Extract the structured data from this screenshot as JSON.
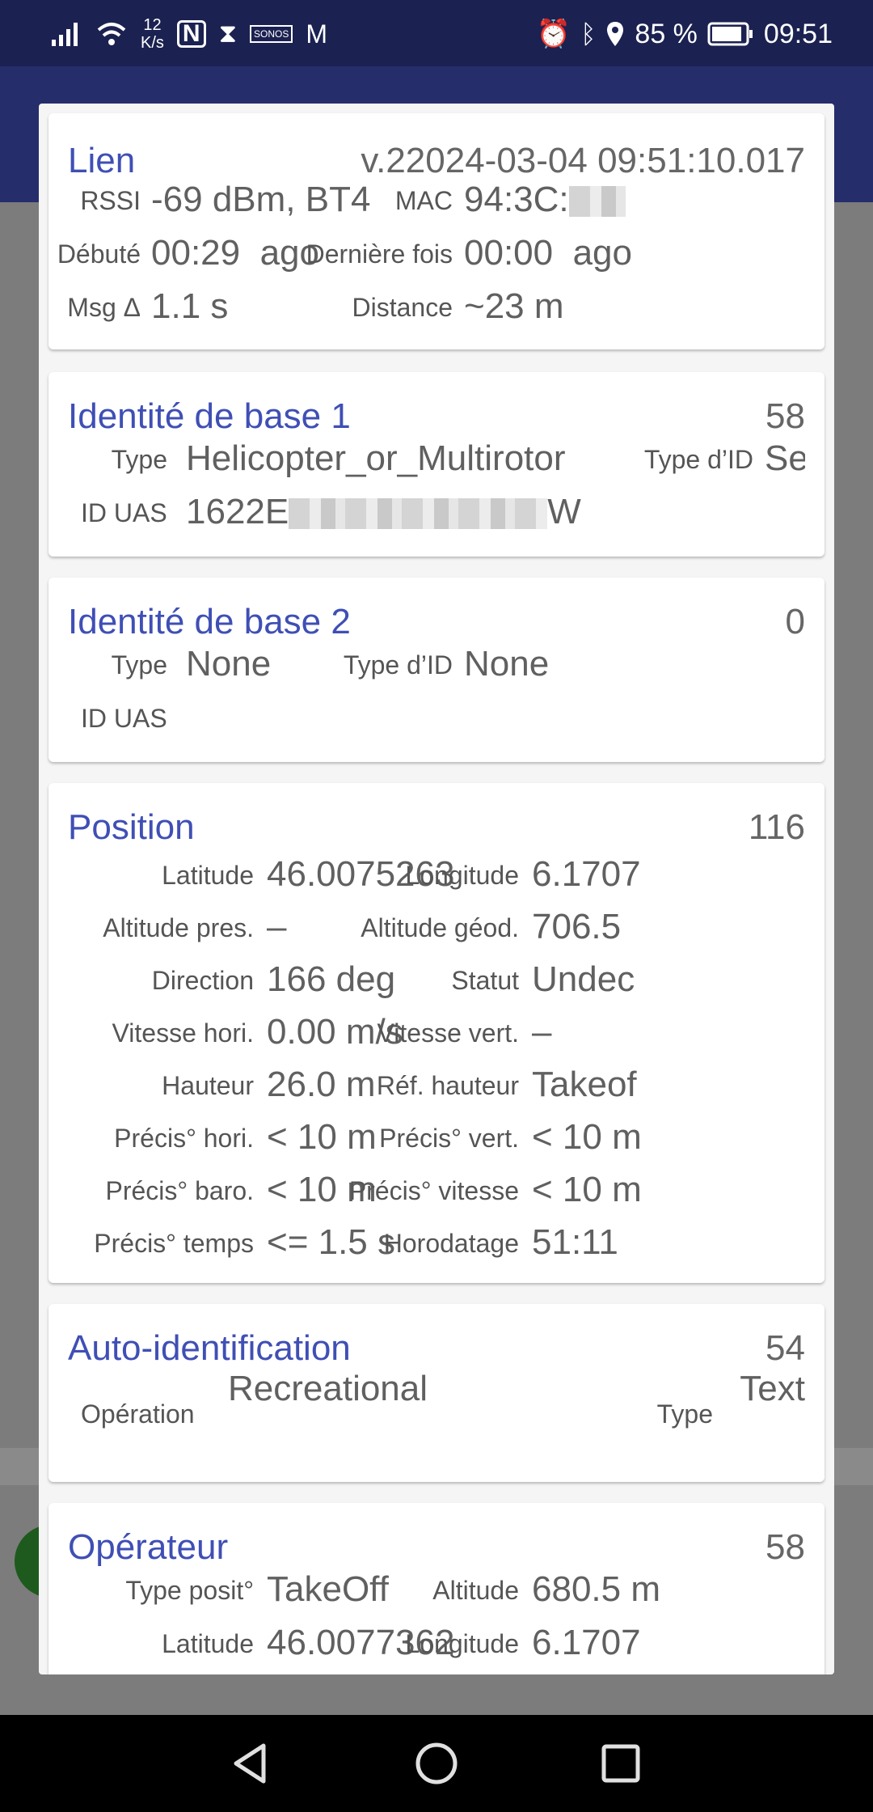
{
  "status_bar": {
    "signal_icon": "signal-bars-icon",
    "wifi_icon": "wifi-icon",
    "speed": "12",
    "speed_unit": "K/s",
    "battery": "85 %",
    "time": "09:51"
  },
  "link": {
    "title": "Lien",
    "version": "v.22024-03-04 09:51:10.017",
    "rssi_label": "RSSI",
    "rssi_value": "-69 dBm, BT4",
    "mac_label": "MAC",
    "mac_value": "94:3C:",
    "started_label": "Débuté",
    "started_value": "00:29",
    "started_suffix": "ago",
    "last_label": "Dernière fois",
    "last_value": "00:00",
    "last_suffix": "ago",
    "msg_label": "Msg Δ",
    "msg_value": "1.1 s",
    "distance_label": "Distance",
    "distance_value": "~23 m"
  },
  "basic_id_1": {
    "title": "Identité de base 1",
    "count": "58",
    "type_label": "Type",
    "type_value": "Helicopter_or_Multirotor",
    "id_type_label": "Type d’ID",
    "id_type_value": "Se",
    "uas_label": "ID UAS",
    "uas_prefix": "1622E",
    "uas_suffix": "W"
  },
  "basic_id_2": {
    "title": "Identité de base 2",
    "count": "0",
    "type_label": "Type",
    "type_value": "None",
    "id_type_label": "Type d’ID",
    "id_type_value": "None",
    "uas_label": "ID UAS"
  },
  "position": {
    "title": "Position",
    "count": "116",
    "rows": [
      {
        "l1": "Latitude",
        "v1": "46.0075263",
        "l2": "Longitude",
        "v2": "6.1707"
      },
      {
        "l1": "Altitude pres.",
        "v1": "–",
        "l2": "Altitude géod.",
        "v2": "706.5"
      },
      {
        "l1": "Direction",
        "v1": "166 deg",
        "l2": "Statut",
        "v2": "Undec"
      },
      {
        "l1": "Vitesse hori.",
        "v1": "0.00 m/s",
        "l2": "Vitesse vert.",
        "v2": "–"
      },
      {
        "l1": "Hauteur",
        "v1": "26.0 m",
        "l2": "Réf. hauteur",
        "v2": "Takeof"
      },
      {
        "l1": "Précis° hori.",
        "v1": "< 10 m",
        "l2": "Précis° vert.",
        "v2": "< 10 m"
      },
      {
        "l1": "Précis° baro.",
        "v1": "< 10 m",
        "l2": "Précis° vitesse",
        "v2": "< 10 m"
      },
      {
        "l1": "Précis° temps",
        "v1": "<= 1.5 s",
        "l2": "Horodatage",
        "v2": "51:11"
      }
    ]
  },
  "self_id": {
    "title": "Auto-identification",
    "count": "54",
    "operation_label": "Opération",
    "operation_value": "Recreational",
    "type_label": "Type",
    "type_value": "Text"
  },
  "operator": {
    "title": "Opérateur",
    "count": "58",
    "pos_type_label": "Type posit°",
    "pos_type_value": "TakeOff",
    "altitude_label": "Altitude",
    "altitude_value": "680.5 m",
    "latitude_label": "Latitude",
    "latitude_value": "46.0077362",
    "longitude_label": "Longitude",
    "longitude_value": "6.1707"
  },
  "nav": {
    "back_icon": "back-triangle-icon",
    "home_icon": "home-circle-icon",
    "recents_icon": "recents-square-icon"
  }
}
